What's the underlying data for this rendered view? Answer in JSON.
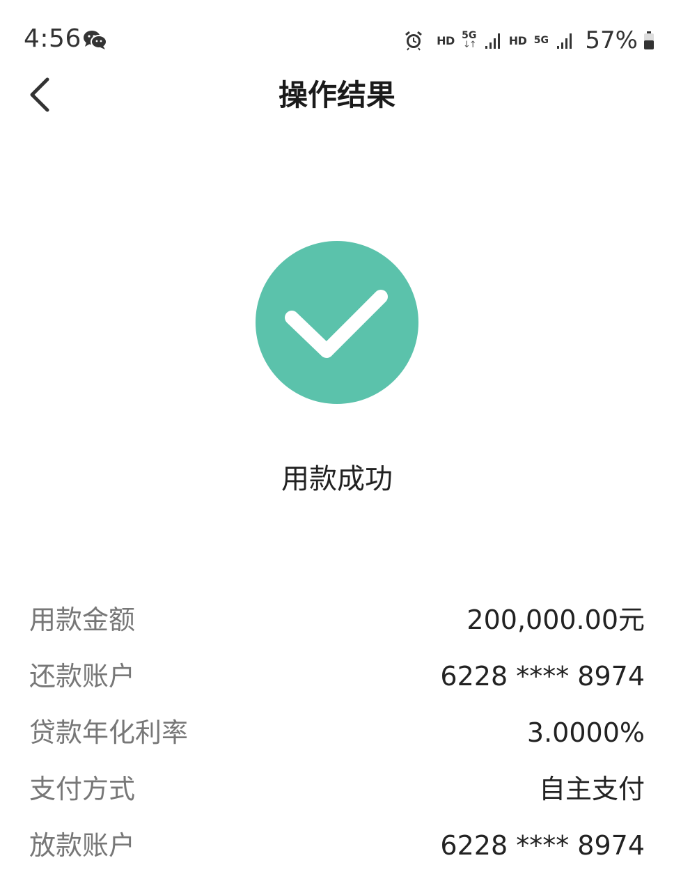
{
  "status_bar": {
    "time": "4:56",
    "hd1": "HD",
    "net1": "5G",
    "net1_arrows": "↓↑",
    "hd2": "HD",
    "net2": "5G",
    "battery": "57%"
  },
  "nav": {
    "title": "操作结果"
  },
  "result": {
    "message": "用款成功",
    "accent_color": "#5bc2ab"
  },
  "details": [
    {
      "label": "用款金额",
      "value": "200,000.00元"
    },
    {
      "label": "还款账户",
      "value": "6228 **** 8974"
    },
    {
      "label": "贷款年化利率",
      "value": "3.0000%"
    },
    {
      "label": "支付方式",
      "value": "自主支付"
    },
    {
      "label": "放款账户",
      "value": "6228 **** 8974"
    }
  ],
  "icons": {
    "messaging": "wechat-icon",
    "alarm": "alarm-icon",
    "back": "chevron-left-icon",
    "success": "checkmark-circle-icon"
  }
}
